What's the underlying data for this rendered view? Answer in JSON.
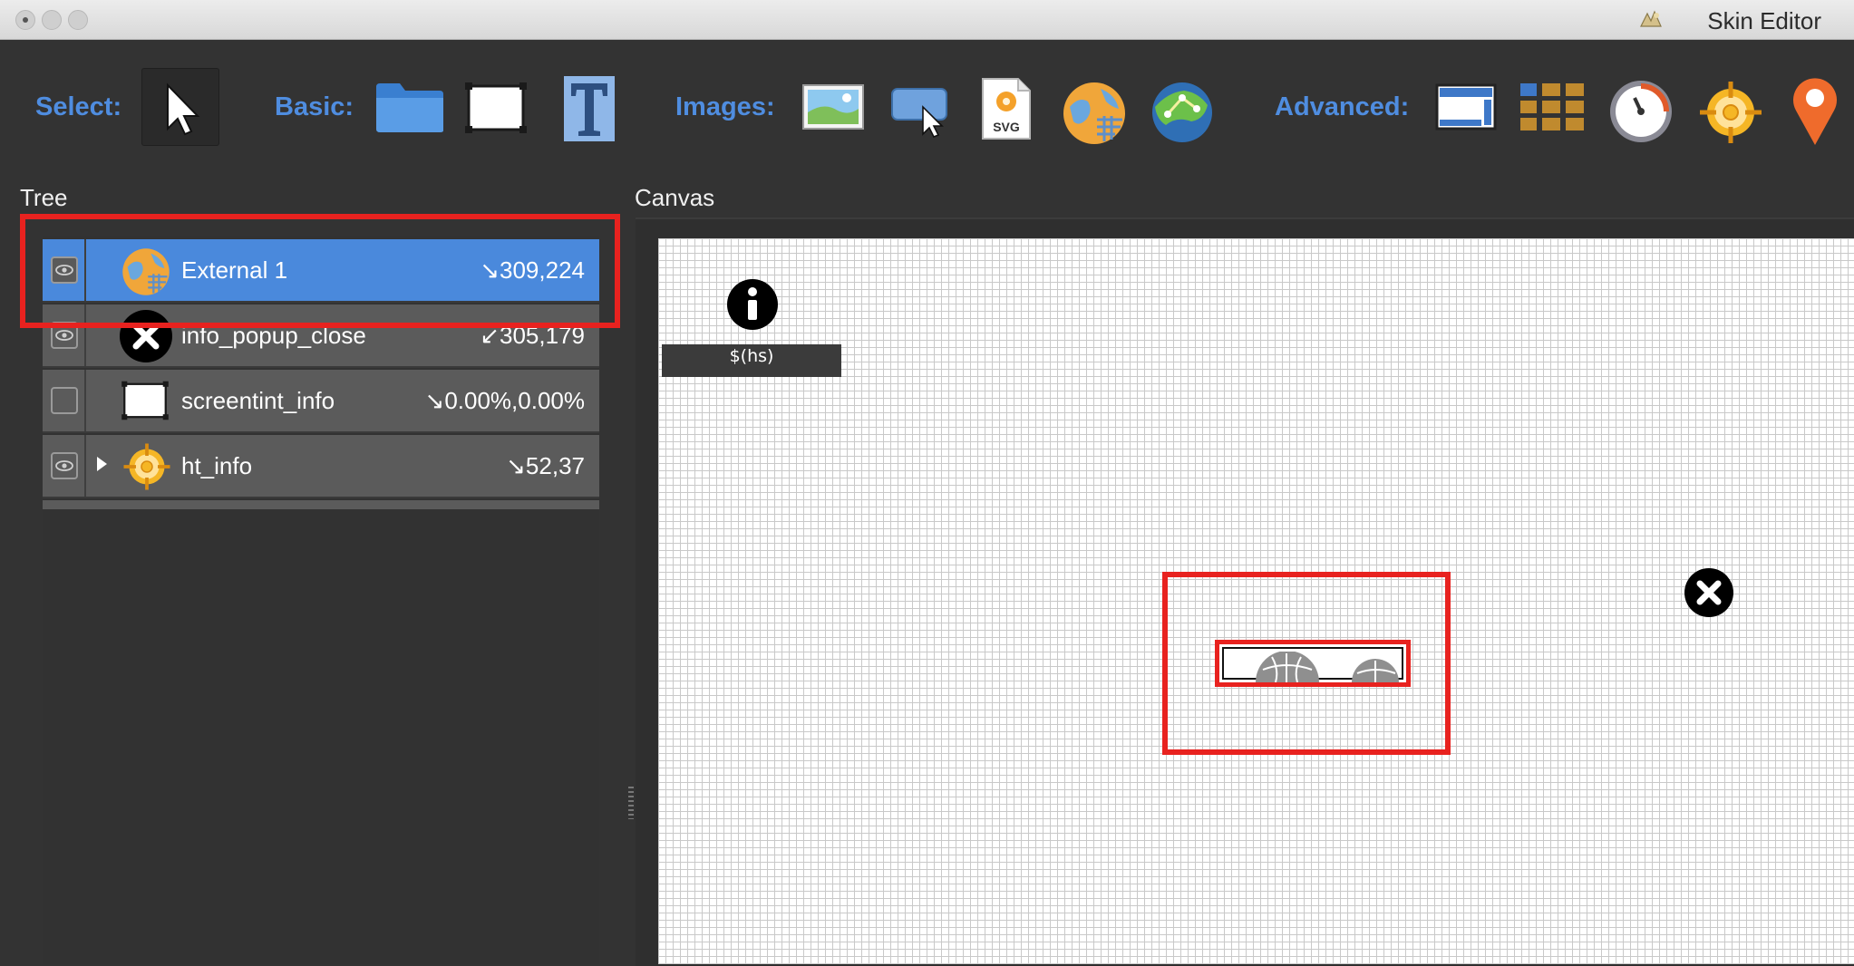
{
  "window": {
    "title": "Skin Editor",
    "traffic_lights": [
      "close",
      "minimize",
      "zoom"
    ]
  },
  "toolbar": {
    "select_label": "Select:",
    "basic_label": "Basic:",
    "images_label": "Images:",
    "advanced_label": "Advanced:",
    "select_tools": [
      "pointer-icon"
    ],
    "basic_tools": [
      "container-icon",
      "rectangle-icon",
      "text-icon"
    ],
    "image_tools": [
      "image-icon",
      "button-icon",
      "svg-icon",
      "external-icon",
      "map-icon"
    ],
    "advanced_tools": [
      "scrollarea-icon",
      "cloner-icon",
      "timer-icon",
      "hotspot-icon",
      "map-pin-icon"
    ],
    "svg_badge": "SVG"
  },
  "tree": {
    "title": "Tree",
    "items": [
      {
        "name": "External 1",
        "coords": "↘309,224",
        "icon": "external-globe-icon",
        "visible": true,
        "selected": true,
        "expandable": false
      },
      {
        "name": "info_popup_close",
        "coords": "↙305,179",
        "icon": "close-circle-icon",
        "visible": true,
        "selected": false,
        "expandable": false
      },
      {
        "name": "screentint_info",
        "coords": "↘0.00%,0.00%",
        "icon": "rectangle-icon",
        "visible": false,
        "selected": false,
        "expandable": false
      },
      {
        "name": "ht_info",
        "coords": "↘52,37",
        "icon": "hotspot-icon",
        "visible": true,
        "selected": false,
        "expandable": true
      }
    ]
  },
  "canvas": {
    "title": "Canvas",
    "hotspot_label": "$(hs)"
  },
  "colors": {
    "accent": "#4f8de0",
    "selected_row": "#4a89dc",
    "highlight": "#e8221f",
    "panel_bg": "#333333"
  }
}
